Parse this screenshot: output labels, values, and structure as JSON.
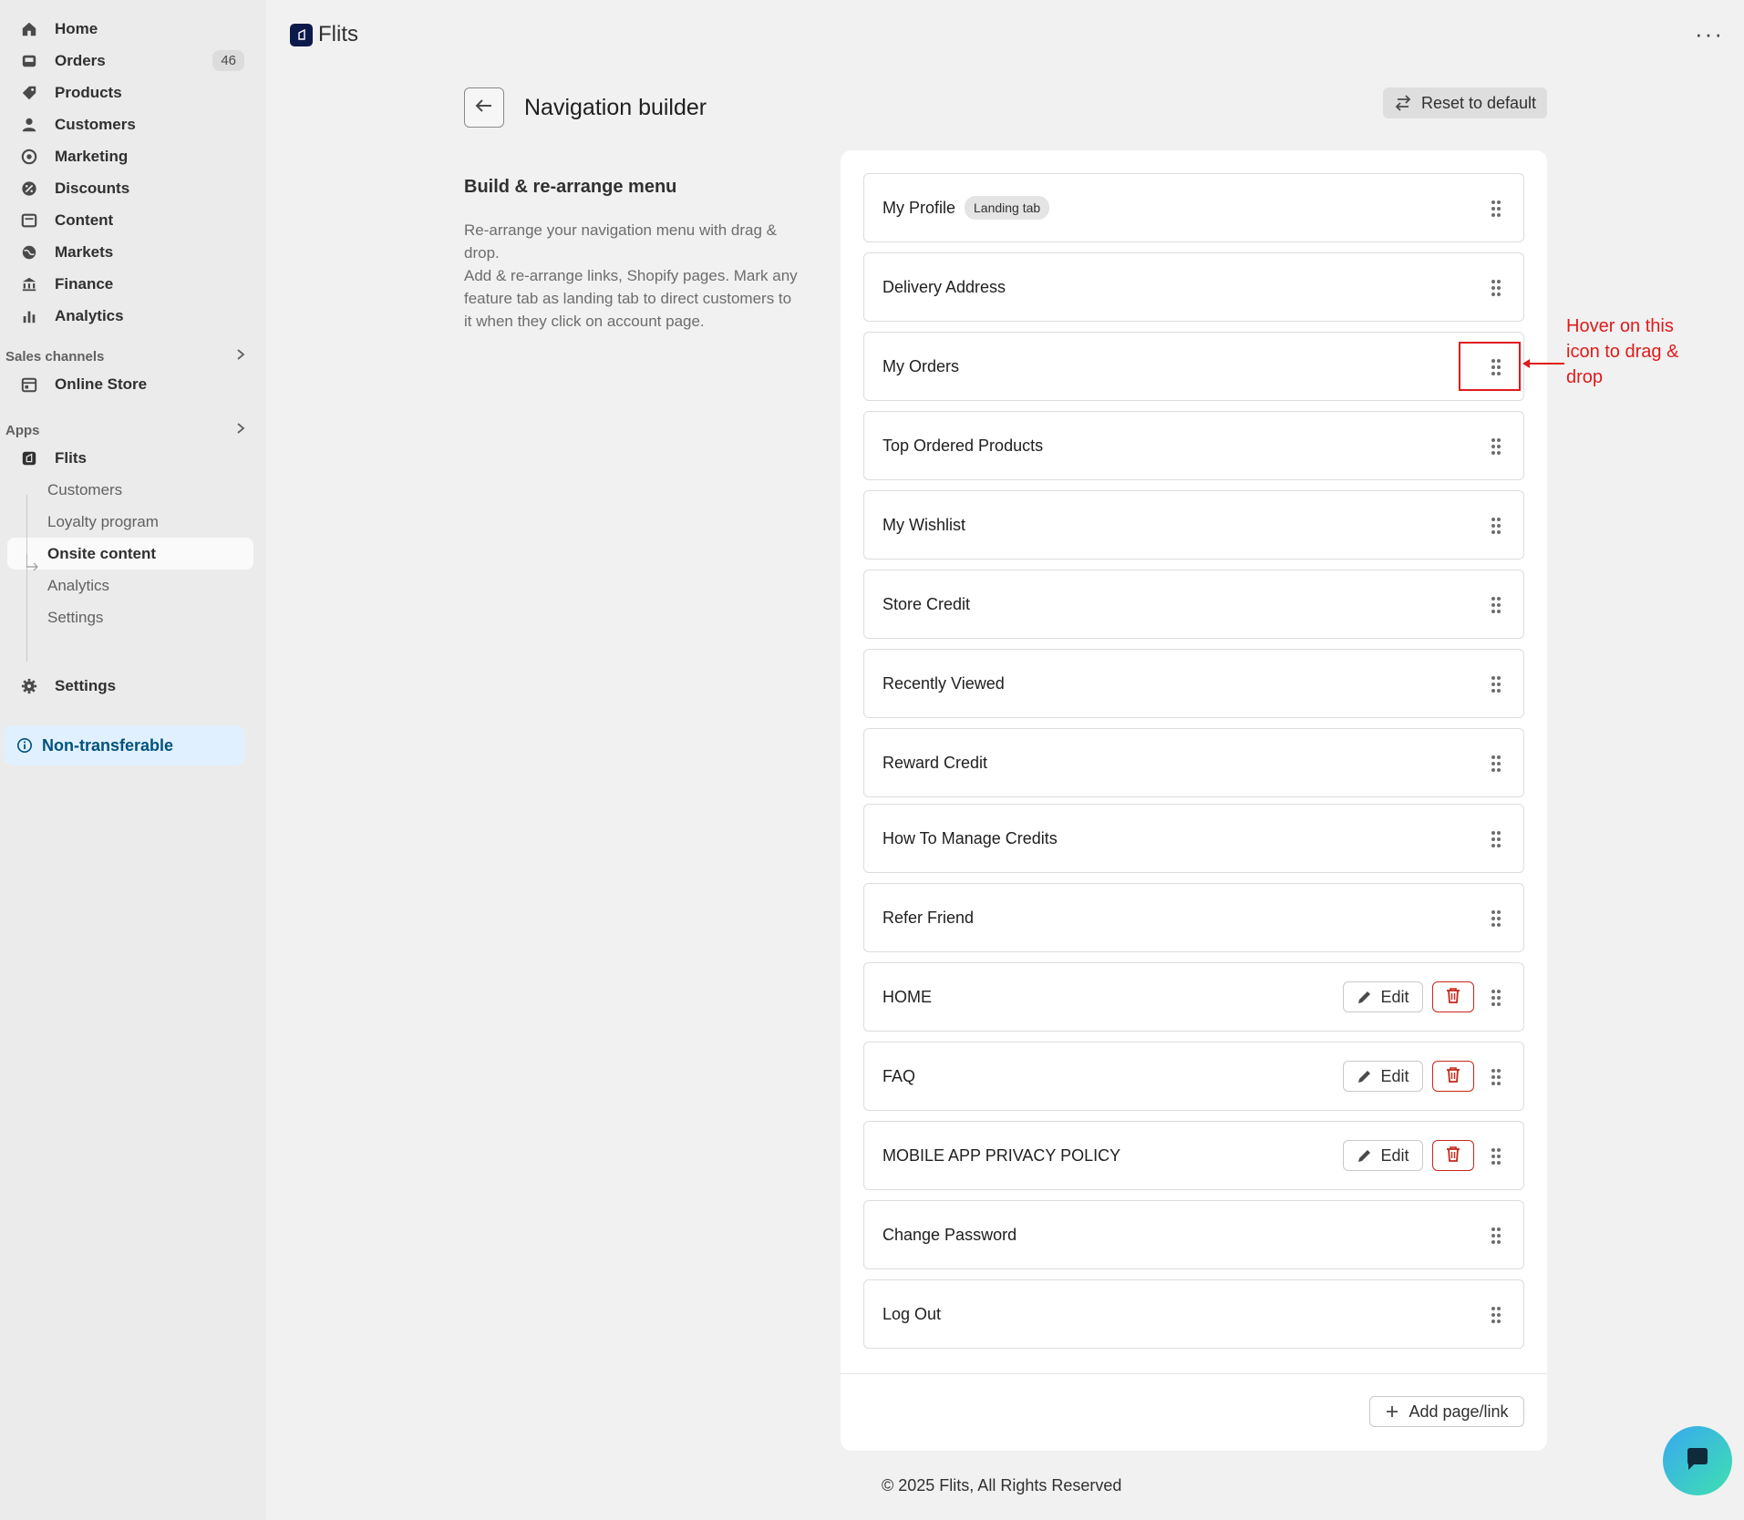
{
  "app": {
    "name": "Flits"
  },
  "sidebar": {
    "main": [
      {
        "label": "Home",
        "icon": "home-icon"
      },
      {
        "label": "Orders",
        "icon": "orders-icon",
        "badge": "46"
      },
      {
        "label": "Products",
        "icon": "tag-icon"
      },
      {
        "label": "Customers",
        "icon": "person-icon"
      },
      {
        "label": "Marketing",
        "icon": "target-icon"
      },
      {
        "label": "Discounts",
        "icon": "discount-icon"
      },
      {
        "label": "Content",
        "icon": "content-icon"
      },
      {
        "label": "Markets",
        "icon": "globe-icon"
      },
      {
        "label": "Finance",
        "icon": "bank-icon"
      },
      {
        "label": "Analytics",
        "icon": "chart-icon"
      }
    ],
    "sales_channels": {
      "label": "Sales channels",
      "items": [
        {
          "label": "Online Store"
        }
      ]
    },
    "apps": {
      "label": "Apps",
      "app_label": "Flits",
      "sub_items": [
        "Customers",
        "Loyalty program",
        "Onsite content",
        "Analytics",
        "Settings"
      ]
    },
    "settings_label": "Settings",
    "non_transferable": "Non-transferable"
  },
  "header": {
    "title": "Navigation builder",
    "reset_label": "Reset to default"
  },
  "description": {
    "title": "Build & re-arrange menu",
    "line1": "Re-arrange your navigation menu with drag & drop.",
    "line2": "Add & re-arrange links, Shopify pages. Mark any feature tab as landing tab to direct customers to it when they click on account page."
  },
  "menu": {
    "landing_tag": "Landing tab",
    "edit_label": "Edit",
    "add_label": "Add page/link",
    "items": [
      "My Profile",
      "Delivery Address",
      "My Orders",
      "Top Ordered Products",
      "My Wishlist",
      "Store Credit",
      "Recently Viewed",
      "Reward Credit",
      "How To Manage Credits",
      "Refer Friend",
      "HOME",
      "FAQ",
      "MOBILE APP PRIVACY POLICY",
      "Change Password",
      "Log Out"
    ]
  },
  "annotation": {
    "text": "Hover on this icon to drag & drop",
    "color": "#e01b1b"
  },
  "footer": {
    "text": "© 2025 Flits, All Rights Reserved"
  }
}
